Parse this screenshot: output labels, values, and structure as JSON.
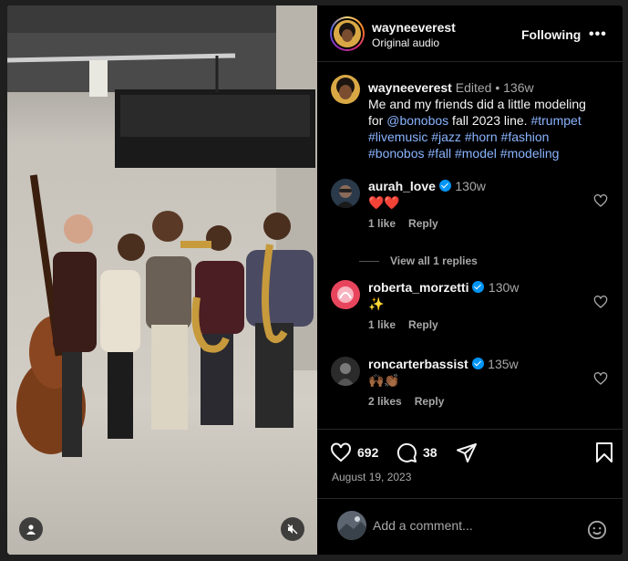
{
  "post": {
    "author": "wayneeverest",
    "audio": "Original audio",
    "follow_label": "Following",
    "more_label": "•••"
  },
  "caption": {
    "username": "wayneeverest",
    "edited": "Edited",
    "separator": "•",
    "age": "136w",
    "text_1": "Me and my friends did a little modeling",
    "text_2a": "for ",
    "mention": "@bonobos",
    "text_2b": " fall 2023 line. ",
    "tag_trumpet": "#trumpet",
    "tag_livemusic": "#livemusic",
    "tag_jazz": "#jazz",
    "tag_horn": "#horn",
    "tag_fashion": "#fashion",
    "tag_bonobos": "#bonobos",
    "tag_fall": "#fall",
    "tag_model": "#model",
    "tag_modeling": "#modeling"
  },
  "comments": [
    {
      "username": "aurah_love",
      "age": "130w",
      "text": "❤️❤️",
      "likes": "1 like",
      "reply": "Reply"
    },
    {
      "username": "roberta_morzetti",
      "age": "130w",
      "text": "✨",
      "likes": "1 like",
      "reply": "Reply"
    },
    {
      "username": "roncarterbassist",
      "age": "135w",
      "text": "🙌🏾👏🏾",
      "likes": "2 likes",
      "reply": "Reply"
    }
  ],
  "view_replies": "View all 1 replies",
  "footer": {
    "likes": "692",
    "comments": "38",
    "date": "August 19, 2023",
    "add_comment_placeholder": "Add a comment..."
  },
  "colors": {
    "background": "#000000",
    "text": "#f5f5f5",
    "muted": "#a8a8a8",
    "link": "#8ab4ff",
    "verified": "#0095f6",
    "heart_red": "#ff3040"
  }
}
